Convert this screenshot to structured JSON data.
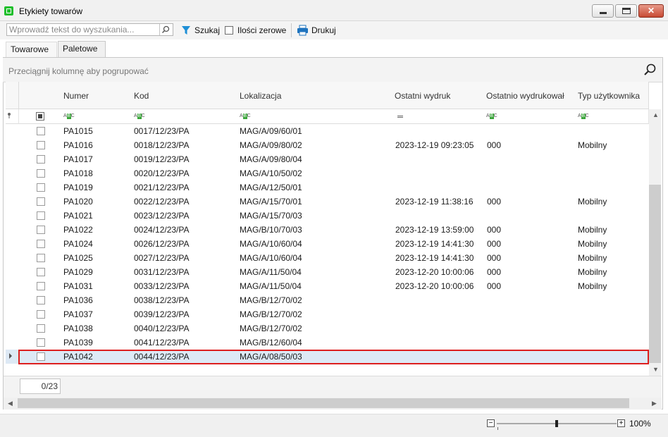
{
  "window": {
    "title": "Etykiety towarów",
    "controls": {
      "minimize": "minimize-icon",
      "maximize": "maximize-icon",
      "close": "close-icon"
    }
  },
  "toolbar": {
    "search_placeholder": "Wprowadź tekst do wyszukania...",
    "search_value": "",
    "search_button_label": "Szukaj",
    "zero_qty_label": "Ilości zerowe",
    "zero_qty_checked": false,
    "print_label": "Drukuj"
  },
  "tabs": [
    {
      "label": "Towarowe",
      "active": false
    },
    {
      "label": "Paletowe",
      "active": true
    }
  ],
  "grid": {
    "group_hint": "Przeciągnij kolumnę aby pogrupować",
    "columns": [
      "Numer",
      "Kod",
      "Lokalizacja",
      "Ostatni wydruk",
      "Ostatnio wydrukował",
      "Typ użytkownika"
    ],
    "rows": [
      {
        "numer": "PA1015",
        "kod": "0017/12/23/PA",
        "lok": "MAG/A/09/60/01",
        "wydruk": "",
        "kto": "",
        "typ": ""
      },
      {
        "numer": "PA1016",
        "kod": "0018/12/23/PA",
        "lok": "MAG/A/09/80/02",
        "wydruk": "2023-12-19 09:23:05",
        "kto": "000",
        "typ": "Mobilny"
      },
      {
        "numer": "PA1017",
        "kod": "0019/12/23/PA",
        "lok": "MAG/A/09/80/04",
        "wydruk": "",
        "kto": "",
        "typ": ""
      },
      {
        "numer": "PA1018",
        "kod": "0020/12/23/PA",
        "lok": "MAG/A/10/50/02",
        "wydruk": "",
        "kto": "",
        "typ": ""
      },
      {
        "numer": "PA1019",
        "kod": "0021/12/23/PA",
        "lok": "MAG/A/12/50/01",
        "wydruk": "",
        "kto": "",
        "typ": ""
      },
      {
        "numer": "PA1020",
        "kod": "0022/12/23/PA",
        "lok": "MAG/A/15/70/01",
        "wydruk": "2023-12-19 11:38:16",
        "kto": "000",
        "typ": "Mobilny"
      },
      {
        "numer": "PA1021",
        "kod": "0023/12/23/PA",
        "lok": "MAG/A/15/70/03",
        "wydruk": "",
        "kto": "",
        "typ": ""
      },
      {
        "numer": "PA1022",
        "kod": "0024/12/23/PA",
        "lok": "MAG/B/10/70/03",
        "wydruk": "2023-12-19 13:59:00",
        "kto": "000",
        "typ": "Mobilny"
      },
      {
        "numer": "PA1024",
        "kod": "0026/12/23/PA",
        "lok": "MAG/A/10/60/04",
        "wydruk": "2023-12-19 14:41:30",
        "kto": "000",
        "typ": "Mobilny"
      },
      {
        "numer": "PA1025",
        "kod": "0027/12/23/PA",
        "lok": "MAG/A/10/60/04",
        "wydruk": "2023-12-19 14:41:30",
        "kto": "000",
        "typ": "Mobilny"
      },
      {
        "numer": "PA1029",
        "kod": "0031/12/23/PA",
        "lok": "MAG/A/11/50/04",
        "wydruk": "2023-12-20 10:00:06",
        "kto": "000",
        "typ": "Mobilny"
      },
      {
        "numer": "PA1031",
        "kod": "0033/12/23/PA",
        "lok": "MAG/A/11/50/04",
        "wydruk": "2023-12-20 10:00:06",
        "kto": "000",
        "typ": "Mobilny"
      },
      {
        "numer": "PA1036",
        "kod": "0038/12/23/PA",
        "lok": "MAG/B/12/70/02",
        "wydruk": "",
        "kto": "",
        "typ": ""
      },
      {
        "numer": "PA1037",
        "kod": "0039/12/23/PA",
        "lok": "MAG/B/12/70/02",
        "wydruk": "",
        "kto": "",
        "typ": ""
      },
      {
        "numer": "PA1038",
        "kod": "0040/12/23/PA",
        "lok": "MAG/B/12/70/02",
        "wydruk": "",
        "kto": "",
        "typ": ""
      },
      {
        "numer": "PA1039",
        "kod": "0041/12/23/PA",
        "lok": "MAG/B/12/60/04",
        "wydruk": "",
        "kto": "",
        "typ": ""
      },
      {
        "numer": "PA1042",
        "kod": "0044/12/23/PA",
        "lok": "MAG/A/08/50/03",
        "wydruk": "",
        "kto": "",
        "typ": "",
        "selected": true
      }
    ],
    "counter": "0/23"
  },
  "status": {
    "zoom": "100%",
    "zoom_minus": "−",
    "zoom_plus": "+"
  },
  "colors": {
    "selection_outline": "#dd1f1f",
    "selected_row": "#dde9f5",
    "app_icon": "#1fbf2c",
    "print_icon": "#1e73be",
    "filter_icon": "#1e8fd6"
  }
}
